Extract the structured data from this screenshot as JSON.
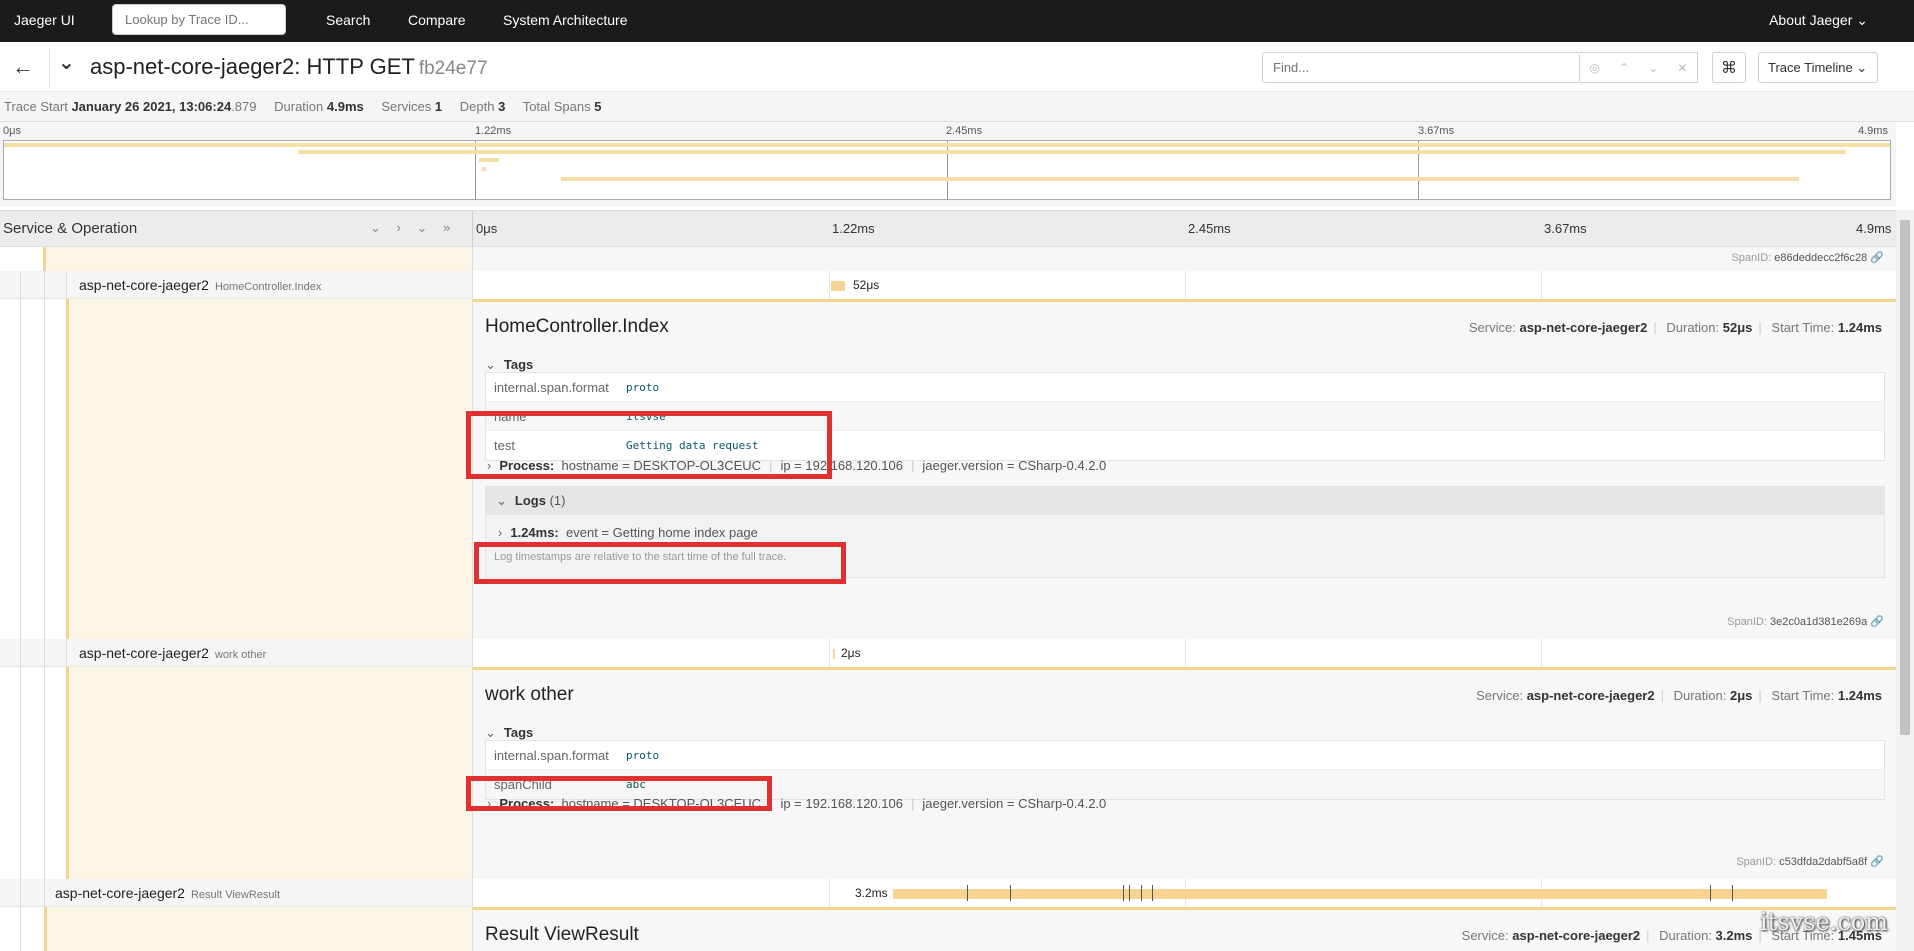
{
  "nav": {
    "brand": "Jaeger UI",
    "lookup_placeholder": "Lookup by Trace ID...",
    "search": "Search",
    "compare": "Compare",
    "architecture": "System Architecture",
    "about": "About Jaeger ⌄"
  },
  "trace": {
    "title": "asp-net-core-jaeger2: HTTP GET",
    "trace_id": "fb24e77",
    "find_placeholder": "Find...",
    "view": "Trace Timeline ⌄",
    "start_label": "Trace Start",
    "start_value": "January 26 2021, 13:06:24",
    "start_ms": ".879",
    "duration_label": "Duration",
    "duration": "4.9ms",
    "services_label": "Services",
    "services": "1",
    "depth_label": "Depth",
    "depth": "3",
    "spans_label": "Total Spans",
    "spans": "5"
  },
  "ticks": [
    "0μs",
    "1.22ms",
    "2.45ms",
    "3.67ms",
    "4.9ms"
  ],
  "header": {
    "service_operation": "Service & Operation"
  },
  "rows": {
    "top_spanid_label": "SpanID:",
    "top_spanid": "e86deddecc2f6c28",
    "home": {
      "service": "asp-net-core-jaeger2",
      "operation": "HomeController.Index",
      "duration_label": "52μs",
      "title": "HomeController.Index",
      "meta_service_label": "Service:",
      "meta_service": "asp-net-core-jaeger2",
      "meta_duration_label": "Duration:",
      "meta_duration": "52μs",
      "meta_start_label": "Start Time:",
      "meta_start": "1.24ms",
      "tags_label": "Tags",
      "tags": [
        {
          "key": "internal.span.format",
          "value": "proto"
        },
        {
          "key": "name",
          "value": "itsvse"
        },
        {
          "key": "test",
          "value": "Getting data request"
        }
      ],
      "process_label": "Process:",
      "process": [
        "hostname = DESKTOP-OL3CEUC",
        "ip = 192.168.120.106",
        "jaeger.version = CSharp-0.4.2.0"
      ],
      "logs_label": "Logs",
      "logs_count": "(1)",
      "log_time": "1.24ms:",
      "log_text": "event = Getting home index page",
      "log_note": "Log timestamps are relative to the start time of the full trace.",
      "spanid_label": "SpanID:",
      "spanid": "3e2c0a1d381e269a"
    },
    "work": {
      "service": "asp-net-core-jaeger2",
      "operation": "work other",
      "duration_label": "2μs",
      "title": "work other",
      "meta_service_label": "Service:",
      "meta_service": "asp-net-core-jaeger2",
      "meta_duration_label": "Duration:",
      "meta_duration": "2μs",
      "meta_start_label": "Start Time:",
      "meta_start": "1.24ms",
      "tags_label": "Tags",
      "tags": [
        {
          "key": "internal.span.format",
          "value": "proto"
        },
        {
          "key": "spanChild",
          "value": "abc"
        }
      ],
      "process_label": "Process:",
      "process": [
        "hostname = DESKTOP-OL3CEUC",
        "ip = 192.168.120.106",
        "jaeger.version = CSharp-0.4.2.0"
      ],
      "spanid_label": "SpanID:",
      "spanid": "c53dfda2dabf5a8f"
    },
    "result": {
      "service": "asp-net-core-jaeger2",
      "operation": "Result ViewResult",
      "duration_label": "3.2ms",
      "title": "Result ViewResult",
      "meta_service_label": "Service:",
      "meta_service": "asp-net-core-jaeger2",
      "meta_duration_label": "Duration:",
      "meta_duration": "3.2ms",
      "meta_start_label": "Start Time:",
      "meta_start": "1.45ms"
    }
  },
  "watermark": "itsvse.com"
}
